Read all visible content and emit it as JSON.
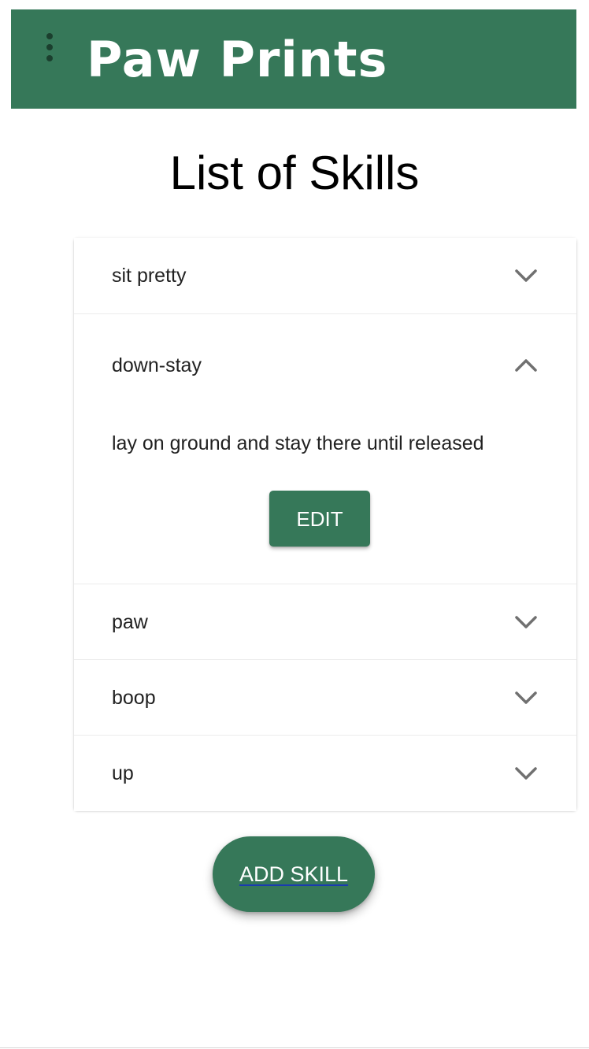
{
  "app_bar": {
    "title": "Paw Prints",
    "menu_icon": "more-vert-icon",
    "background_color": "#367859"
  },
  "page": {
    "title": "List of Skills"
  },
  "skills": [
    {
      "name": "sit pretty",
      "expanded": false,
      "icon": "chevron-down-icon"
    },
    {
      "name": "down-stay",
      "expanded": true,
      "icon": "chevron-up-icon",
      "description": "lay on ground and stay there until released",
      "edit_label": "EDIT"
    },
    {
      "name": "paw",
      "expanded": false,
      "icon": "chevron-down-icon"
    },
    {
      "name": "boop",
      "expanded": false,
      "icon": "chevron-down-icon"
    },
    {
      "name": "up",
      "expanded": false,
      "icon": "chevron-down-icon"
    }
  ],
  "actions": {
    "add_skill_label": "ADD SKILL"
  },
  "colors": {
    "accent": "#367859",
    "text": "#212121",
    "icon": "#707070"
  }
}
